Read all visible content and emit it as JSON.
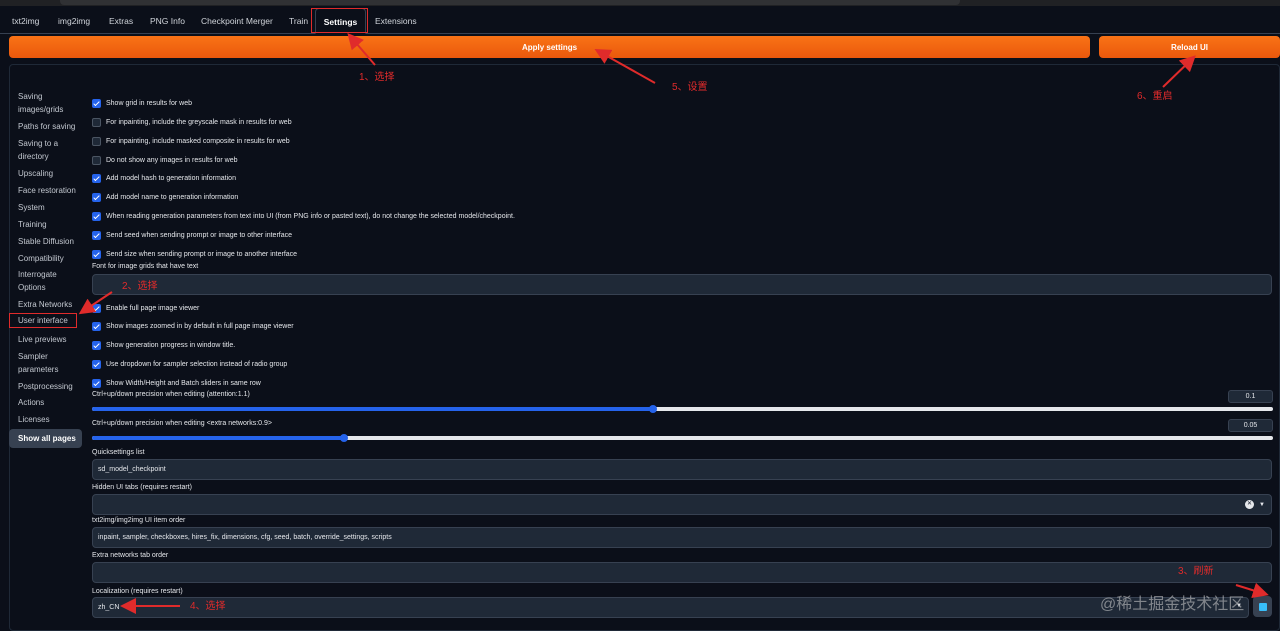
{
  "tabs": [
    {
      "label": "txt2img"
    },
    {
      "label": "img2img"
    },
    {
      "label": "Extras"
    },
    {
      "label": "PNG Info"
    },
    {
      "label": "Checkpoint Merger"
    },
    {
      "label": "Train"
    },
    {
      "label": "Settings",
      "active": true
    },
    {
      "label": "Extensions"
    }
  ],
  "buttons": {
    "apply": "Apply settings",
    "reload": "Reload UI"
  },
  "sidebar": {
    "items": [
      {
        "label": "Saving images/grids"
      },
      {
        "label": "Paths for saving"
      },
      {
        "label": "Saving to a directory"
      },
      {
        "label": "Upscaling"
      },
      {
        "label": "Face restoration"
      },
      {
        "label": "System"
      },
      {
        "label": "Training"
      },
      {
        "label": "Stable Diffusion"
      },
      {
        "label": "Compatibility"
      },
      {
        "label": "Interrogate Options"
      },
      {
        "label": "Extra Networks"
      },
      {
        "label": "User interface",
        "selected": true
      },
      {
        "label": "Live previews"
      },
      {
        "label": "Sampler parameters"
      },
      {
        "label": "Postprocessing"
      },
      {
        "label": "Actions"
      },
      {
        "label": "Licenses"
      }
    ],
    "show_all": "Show all pages"
  },
  "checkboxes_a": [
    {
      "label": "Show grid in results for web",
      "checked": true
    },
    {
      "label": "For inpainting, include the greyscale mask in results for web",
      "checked": false
    },
    {
      "label": "For inpainting, include masked composite in results for web",
      "checked": false
    },
    {
      "label": "Do not show any images in results for web",
      "checked": false
    },
    {
      "label": "Add model hash to generation information",
      "checked": true
    },
    {
      "label": "Add model name to generation information",
      "checked": true
    },
    {
      "label": "When reading generation parameters from text into UI (from PNG info or pasted text), do not change the selected model/checkpoint.",
      "checked": true
    },
    {
      "label": "Send seed when sending prompt or image to other interface",
      "checked": true
    },
    {
      "label": "Send size when sending prompt or image to another interface",
      "checked": true
    }
  ],
  "font_field": {
    "label": "Font for image grids that have text",
    "value": ""
  },
  "checkboxes_b": [
    {
      "label": "Enable full page image viewer",
      "checked": true
    },
    {
      "label": "Show images zoomed in by default in full page image viewer",
      "checked": true
    },
    {
      "label": "Show generation progress in window title.",
      "checked": true
    },
    {
      "label": "Use dropdown for sampler selection instead of radio group",
      "checked": true
    },
    {
      "label": "Show Width/Height and Batch sliders in same row",
      "checked": true
    }
  ],
  "slider_attention": {
    "label": "Ctrl+up/down precision when editing (attention:1.1)",
    "value": "0.1",
    "fraction": 0.475
  },
  "slider_extra": {
    "label": "Ctrl+up/down precision when editing <extra networks:0.9>",
    "value": "0.05",
    "fraction": 0.213
  },
  "quicksettings": {
    "label": "Quicksettings list",
    "value": "sd_model_checkpoint"
  },
  "hidden_tabs": {
    "label": "Hidden UI tabs (requires restart)",
    "value": ""
  },
  "item_order": {
    "label": "txt2img/img2img UI item order",
    "value": "inpaint, sampler, checkboxes, hires_fix, dimensions, cfg, seed, batch, override_settings, scripts"
  },
  "extra_tab_order": {
    "label": "Extra networks tab order",
    "value": ""
  },
  "localization": {
    "label": "Localization (requires restart)",
    "value": "zh_CN"
  },
  "annotations": {
    "a1": "1、选择",
    "a2": "2、选择",
    "a3": "3、刷新",
    "a4": "4、选择",
    "a5": "5、设置",
    "a6": "6、重启",
    "color": "#e02b2b"
  },
  "watermark": "@稀土掘金技术社区",
  "colors": {
    "accent": "#f97316",
    "checkbox": "#2563eb",
    "background": "#0b0f19"
  }
}
